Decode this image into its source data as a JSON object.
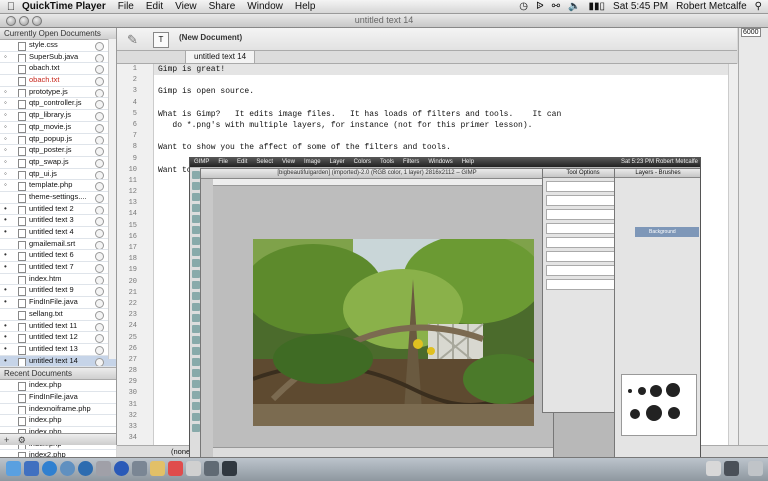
{
  "menubar": {
    "apple": "",
    "app_name": "QuickTime Player",
    "items": [
      "File",
      "Edit",
      "View",
      "Share",
      "Window",
      "Help"
    ],
    "clock": "Sat 5:45 PM",
    "user": "Robert Metcalfe"
  },
  "window": {
    "title": "untitled text 14"
  },
  "sidebar": {
    "open_header": "Currently Open Documents",
    "open_docs": [
      {
        "label": "style.css",
        "bullet": "",
        "color": ""
      },
      {
        "label": "SuperSub.java",
        "bullet": "◦",
        "color": ""
      },
      {
        "label": "obach.txt",
        "bullet": "",
        "color": ""
      },
      {
        "label": "obach.txt",
        "bullet": "",
        "color": "red"
      },
      {
        "label": "prototype.js",
        "bullet": "◦",
        "color": ""
      },
      {
        "label": "qtp_controller.js",
        "bullet": "◦",
        "color": ""
      },
      {
        "label": "qtp_library.js",
        "bullet": "◦",
        "color": ""
      },
      {
        "label": "qtp_movie.js",
        "bullet": "◦",
        "color": ""
      },
      {
        "label": "qtp_popup.js",
        "bullet": "◦",
        "color": ""
      },
      {
        "label": "qtp_poster.js",
        "bullet": "◦",
        "color": ""
      },
      {
        "label": "qtp_swap.js",
        "bullet": "◦",
        "color": ""
      },
      {
        "label": "qtp_ui.js",
        "bullet": "◦",
        "color": ""
      },
      {
        "label": "template.php",
        "bullet": "◦",
        "color": ""
      },
      {
        "label": "theme-settings....",
        "bullet": "",
        "color": ""
      },
      {
        "label": "untitled text 2",
        "bullet": "•",
        "color": ""
      },
      {
        "label": "untitled text 3",
        "bullet": "•",
        "color": ""
      },
      {
        "label": "untitled text 4",
        "bullet": "•",
        "color": ""
      },
      {
        "label": "gmailemail.srt",
        "bullet": "",
        "color": ""
      },
      {
        "label": "untitled text 6",
        "bullet": "•",
        "color": ""
      },
      {
        "label": "untitled text 7",
        "bullet": "•",
        "color": ""
      },
      {
        "label": "index.htm",
        "bullet": "",
        "color": ""
      },
      {
        "label": "untitled text 9",
        "bullet": "•",
        "color": ""
      },
      {
        "label": "FindInFile.java",
        "bullet": "•",
        "color": ""
      },
      {
        "label": "sellang.txt",
        "bullet": "",
        "color": ""
      },
      {
        "label": "untitled text 11",
        "bullet": "•",
        "color": ""
      },
      {
        "label": "untitled text 12",
        "bullet": "•",
        "color": ""
      },
      {
        "label": "untitled text 13",
        "bullet": "•",
        "color": ""
      },
      {
        "label": "untitled text 14",
        "bullet": "•",
        "color": "",
        "selected": true
      }
    ],
    "recent_header": "Recent Documents",
    "recent_docs": [
      "index.php",
      "FindInFile.java",
      "indexnoiframe.php",
      "index.php",
      "index.php",
      "index.php",
      "index2.php",
      "battleshipsandcruis..."
    ],
    "bottom_buttons": [
      "+",
      "⚙"
    ]
  },
  "toolbar": {
    "doc_label": "(New Document)",
    "text_button": "T"
  },
  "tab": {
    "label": "untitled text 14"
  },
  "editor": {
    "line_numbers": [
      "1",
      "2",
      "3",
      "4",
      "5",
      "6",
      "7",
      "8",
      "9",
      "10",
      "11",
      "12",
      "13",
      "14",
      "15",
      "16",
      "17",
      "18",
      "19",
      "20",
      "21",
      "22",
      "23",
      "24",
      "25",
      "26",
      "27",
      "28",
      "29",
      "30",
      "31",
      "32",
      "33",
      "34"
    ],
    "lines": [
      "Gimp is great!",
      "",
      "Gimp is open source.",
      "",
      "What is Gimp?   It edits image files.   It has loads of filters and tools.    It can",
      "   do *.png's with multiple layers, for instance (not for this primer lesson).",
      "",
      "Want to show you the affect of some of the filters and tools.",
      "",
      "Want to show you some export screens at the end."
    ]
  },
  "rightcol": {
    "value": "6000"
  },
  "statusbar": {
    "text": "(none"
  },
  "gimp": {
    "menu": [
      "GIMP",
      "File",
      "Edit",
      "Select",
      "View",
      "Image",
      "Layer",
      "Colors",
      "Tools",
      "Filters",
      "Windows",
      "Help"
    ],
    "clock": "Sat 5:23 PM  Robert Metcalfe",
    "image_title": "[bigbeautifulgarden] (imported)-2.0 (RGB color, 1 layer) 2816x2112 – GIMP",
    "tool_options_title": "Tool Options",
    "layers_title": "Layers - Brushes",
    "layer_name": "Background"
  }
}
